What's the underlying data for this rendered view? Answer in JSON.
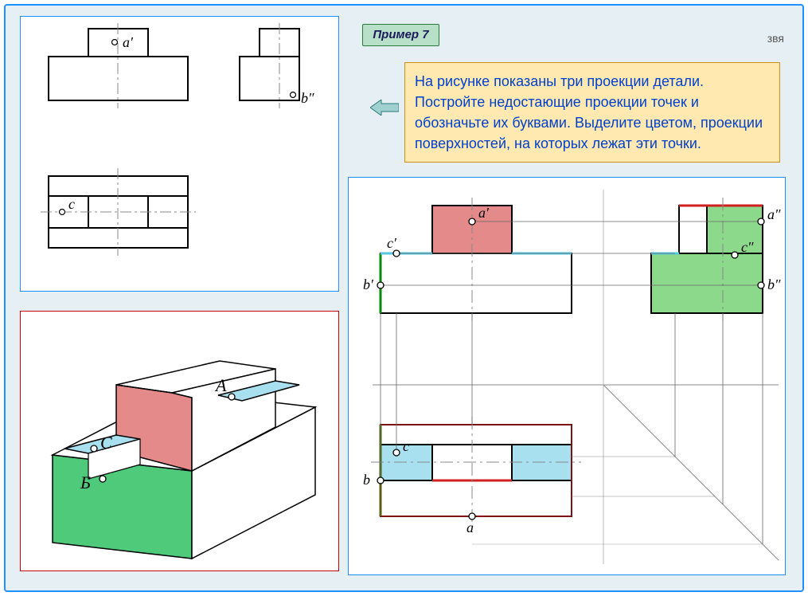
{
  "meta": {
    "example_label": "Пример 7",
    "author_code": "звя"
  },
  "task_text": "На рисунке показаны три проекции детали. Постройте недостающие проекции точек и обозначьте их буквами. Выделите цветом, проекции поверхностей, на которых лежат эти точки.",
  "labels": {
    "panel1": {
      "a_prime": "a′",
      "b_dprime": "b″",
      "c": "c"
    },
    "panel2": {
      "A": "А",
      "B": "Б",
      "C": "С"
    },
    "panel3": {
      "a_prime": "a′",
      "a_dprime": "a″",
      "b_prime": "b′",
      "b_dprime": "b″",
      "c_prime": "c′",
      "c_dprime": "c″",
      "a": "a",
      "b": "b",
      "c": "c"
    }
  },
  "colors": {
    "red_fill": "#e58a8a",
    "green_fill": "#8cd98c",
    "green_dark": "#4fc97a",
    "cyan_fill": "#a8e0f0",
    "axis": "#444",
    "thick": "#000",
    "red_line": "#d02020",
    "blue_line": "#1E90FF",
    "green_line": "#0a8a0a"
  }
}
